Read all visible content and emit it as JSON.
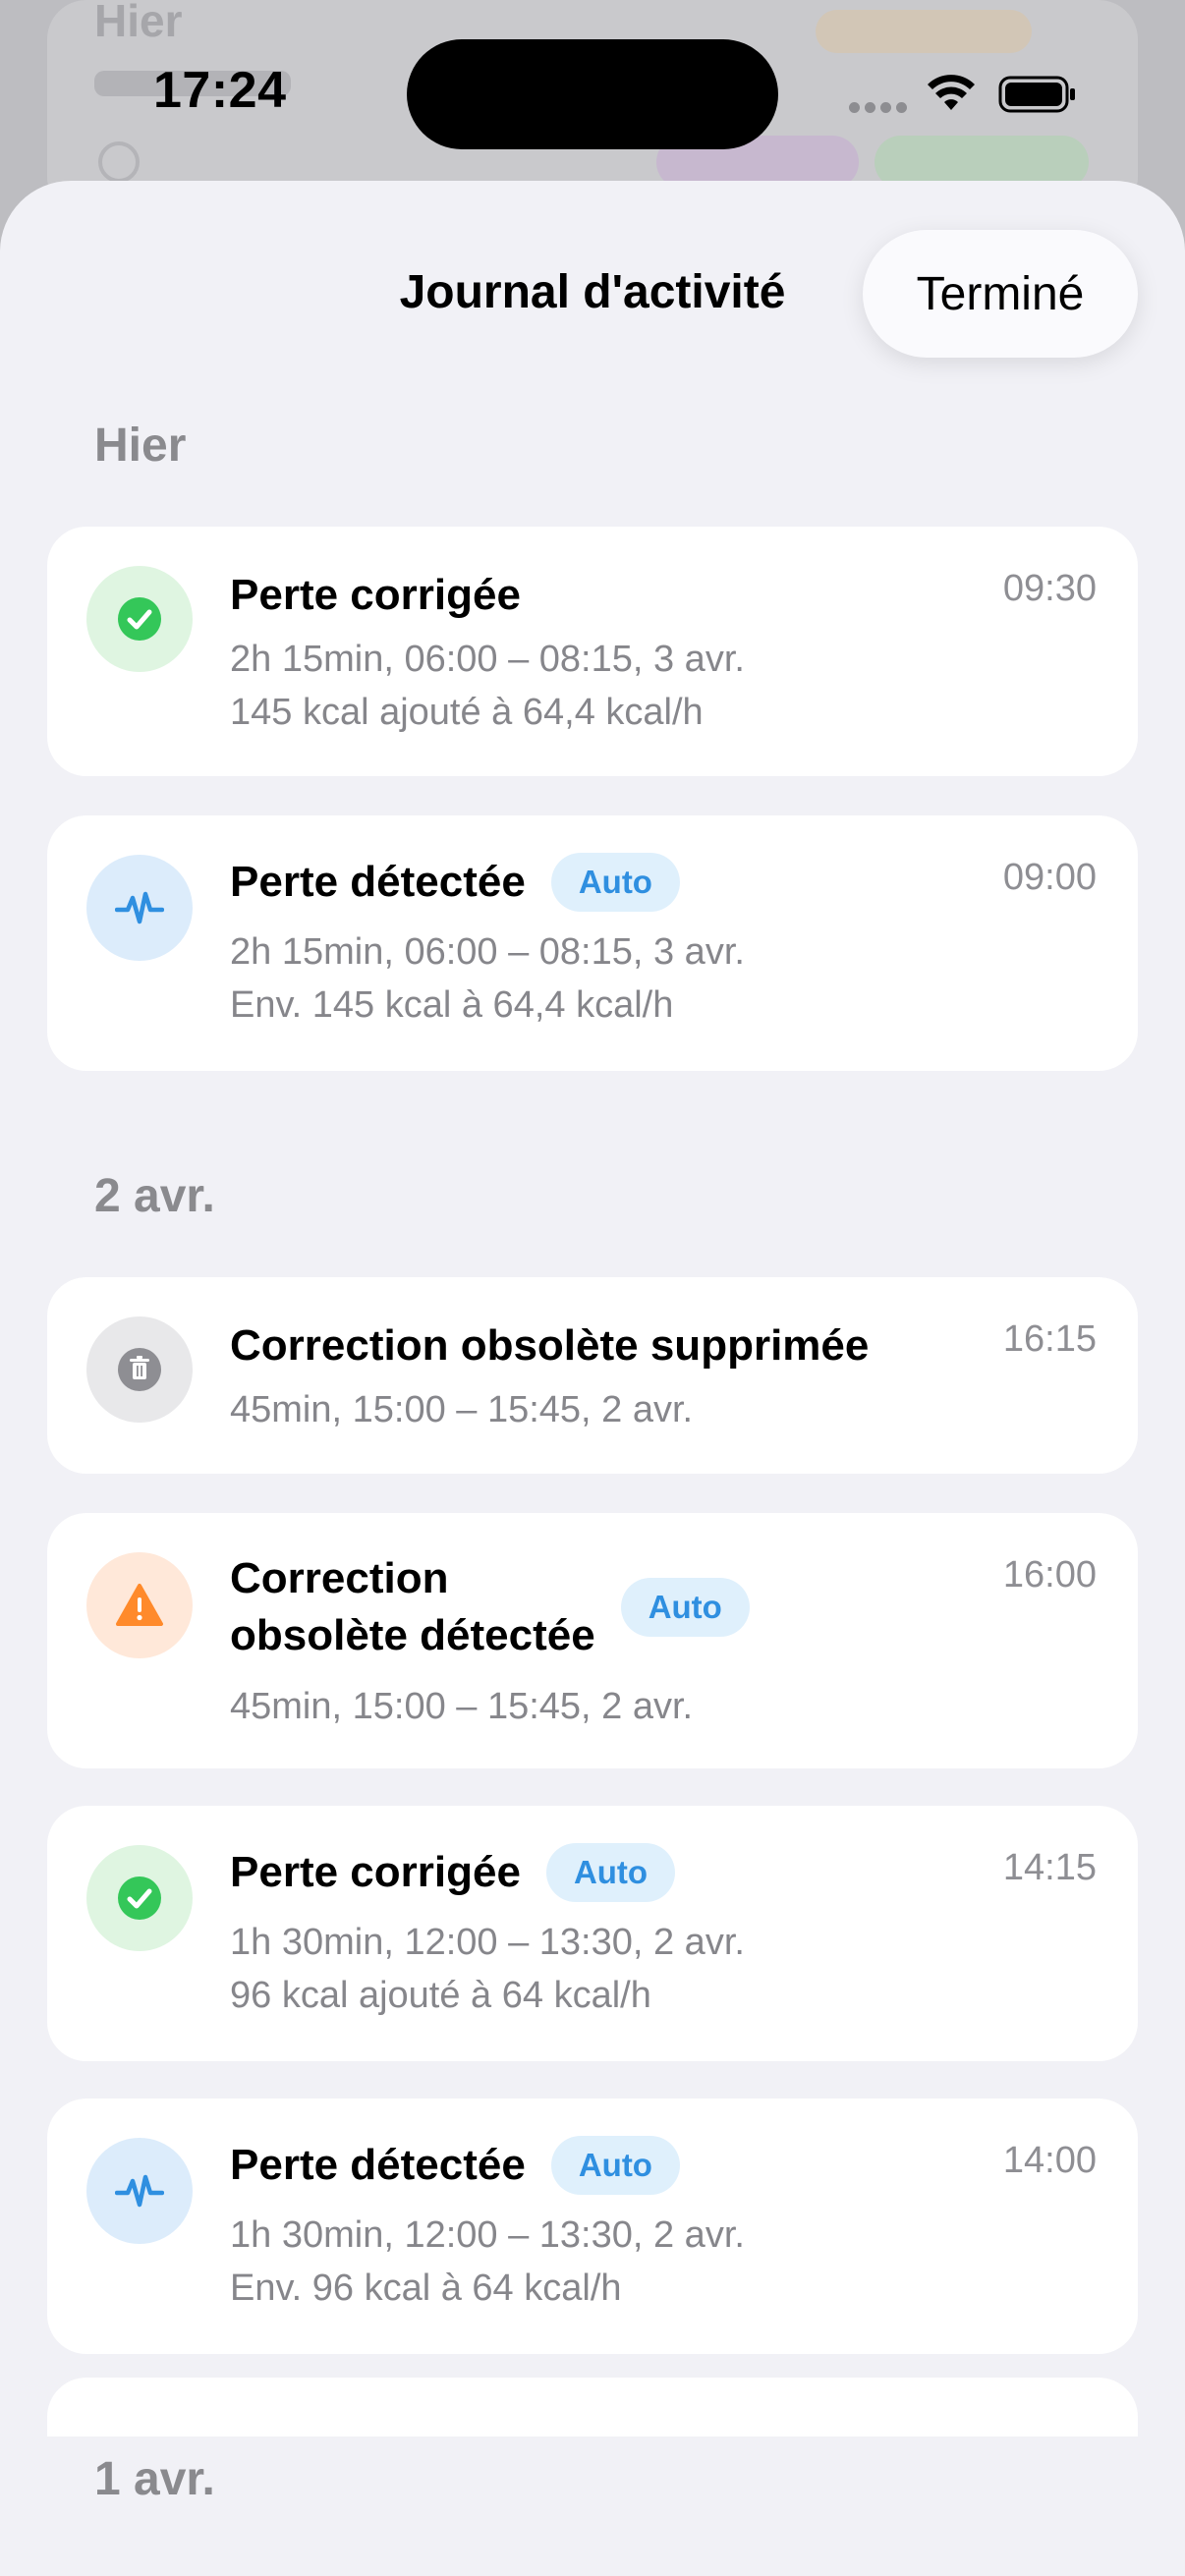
{
  "status_bar": {
    "time": "17:24"
  },
  "background": {
    "title": "Hier"
  },
  "sheet": {
    "title": "Journal d'activité",
    "done_label": "Terminé"
  },
  "sections": [
    {
      "header": "Hier",
      "entries": [
        {
          "icon": "checkmark-icon",
          "title": "Perte corrigée",
          "badge": "",
          "time": "09:30",
          "line1": "2h 15min, 06:00 – 08:15, 3 avr.",
          "line2": "145 kcal ajouté à 64,4 kcal/h"
        },
        {
          "icon": "heartbeat-icon",
          "title": "Perte détectée",
          "badge": "Auto",
          "time": "09:00",
          "line1": "2h 15min, 06:00 – 08:15, 3 avr.",
          "line2": "Env. 145 kcal à 64,4 kcal/h"
        }
      ]
    },
    {
      "header": "2 avr.",
      "entries": [
        {
          "icon": "trash-icon",
          "title": "Correction obsolète supprimée",
          "badge": "",
          "time": "16:15",
          "line1": "45min, 15:00 – 15:45, 2 avr.",
          "line2": ""
        },
        {
          "icon": "warning-icon",
          "title": "Correction obsolète détectée",
          "title_line1": "Correction",
          "title_line2": "obsolète détectée",
          "badge": "Auto",
          "time": "16:00",
          "line1": "45min, 15:00 – 15:45, 2 avr.",
          "line2": ""
        },
        {
          "icon": "checkmark-icon",
          "title": "Perte corrigée",
          "badge": "Auto",
          "time": "14:15",
          "line1": "1h 30min, 12:00 – 13:30, 2 avr.",
          "line2": "96 kcal ajouté à 64 kcal/h"
        },
        {
          "icon": "heartbeat-icon",
          "title": "Perte détectée",
          "badge": "Auto",
          "time": "14:00",
          "line1": "1h 30min, 12:00 – 13:30, 2 avr.",
          "line2": "Env. 96 kcal à 64 kcal/h"
        }
      ]
    },
    {
      "header": "1 avr.",
      "entries": []
    }
  ],
  "colors": {
    "accent_blue": "#2f8fe0",
    "success_green": "#34c759",
    "warning_orange": "#ff8a2b",
    "icon_gray": "#8e8e93"
  }
}
